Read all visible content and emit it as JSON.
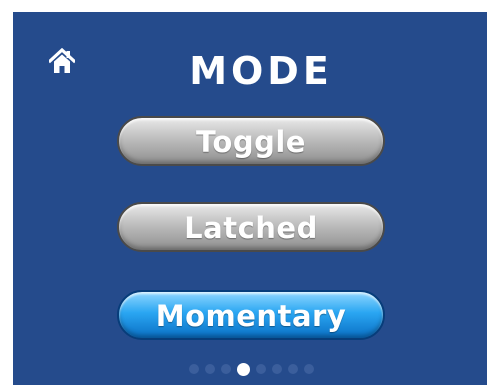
{
  "header": {
    "title": "MODE",
    "home_icon": "home-icon"
  },
  "colors": {
    "screen_background": "#254b8c",
    "button_unselected": "#bdbdbd",
    "button_selected": "#2aa6f2",
    "dot_inactive": "#3b5e9c",
    "dot_active": "#ffffff"
  },
  "mode_options": [
    {
      "label": "Toggle",
      "selected": false
    },
    {
      "label": "Latched",
      "selected": false
    },
    {
      "label": "Momentary",
      "selected": true
    }
  ],
  "pager": {
    "page_count": 8,
    "current_page": 4
  }
}
